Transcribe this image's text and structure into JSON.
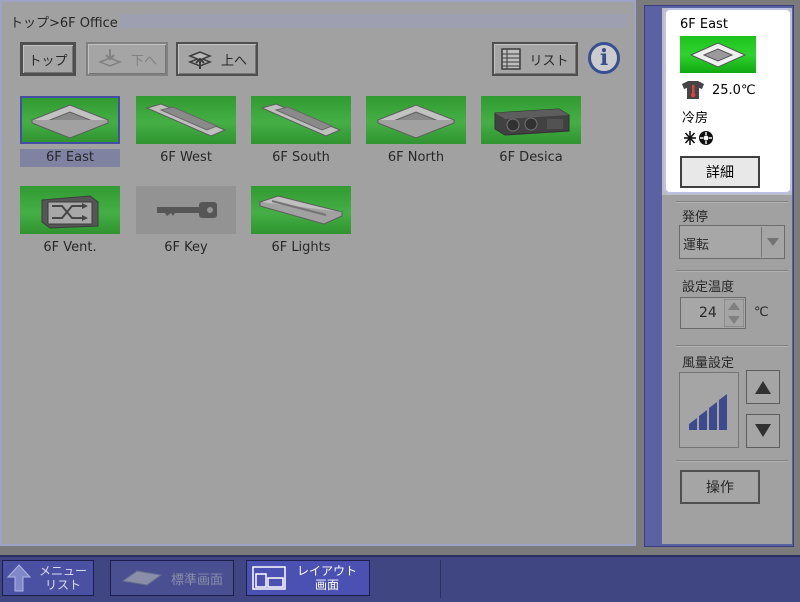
{
  "breadcrumb": "トップ>6F Office",
  "toolbar": {
    "top_label": "トップ",
    "down_label": "下へ",
    "up_label": "上へ",
    "list_label": "リスト",
    "info_label": "i"
  },
  "devices": [
    {
      "label": "6F East",
      "icon": "cassette-ac-icon",
      "status": "green",
      "selected": true
    },
    {
      "label": "6F West",
      "icon": "slim-duct-ac-icon",
      "status": "green"
    },
    {
      "label": "6F South",
      "icon": "slim-duct-ac-icon",
      "status": "green"
    },
    {
      "label": "6F North",
      "icon": "cassette-ac-icon",
      "status": "green"
    },
    {
      "label": "6F Desica",
      "icon": "desica-unit-icon",
      "status": "green"
    },
    {
      "label": "6F Vent.",
      "icon": "ventilator-icon",
      "status": "green"
    },
    {
      "label": "6F Key",
      "icon": "key-icon",
      "status": "gray"
    },
    {
      "label": "6F Lights",
      "icon": "light-fixture-icon",
      "status": "green"
    }
  ],
  "selected_device": {
    "name": "6F East",
    "room_temp": "25.0℃",
    "mode": "冷房",
    "detail_label": "詳細"
  },
  "controls": {
    "onoff_label": "発停",
    "onoff_value": "運転",
    "setpoint_label": "設定温度",
    "setpoint_value": "24",
    "setpoint_unit": "℃",
    "fan_label": "風量設定",
    "operate_label": "操作"
  },
  "bottombar": {
    "menu_line1": "メニュー",
    "menu_line2": "リスト",
    "standard_label": "標準画面",
    "layout_line1": "レイアウト",
    "layout_line2": "画面"
  },
  "colors": {
    "status_green": "#22c422",
    "accent_blue": "#2b3fbf",
    "bottombar": "#3f4682"
  }
}
